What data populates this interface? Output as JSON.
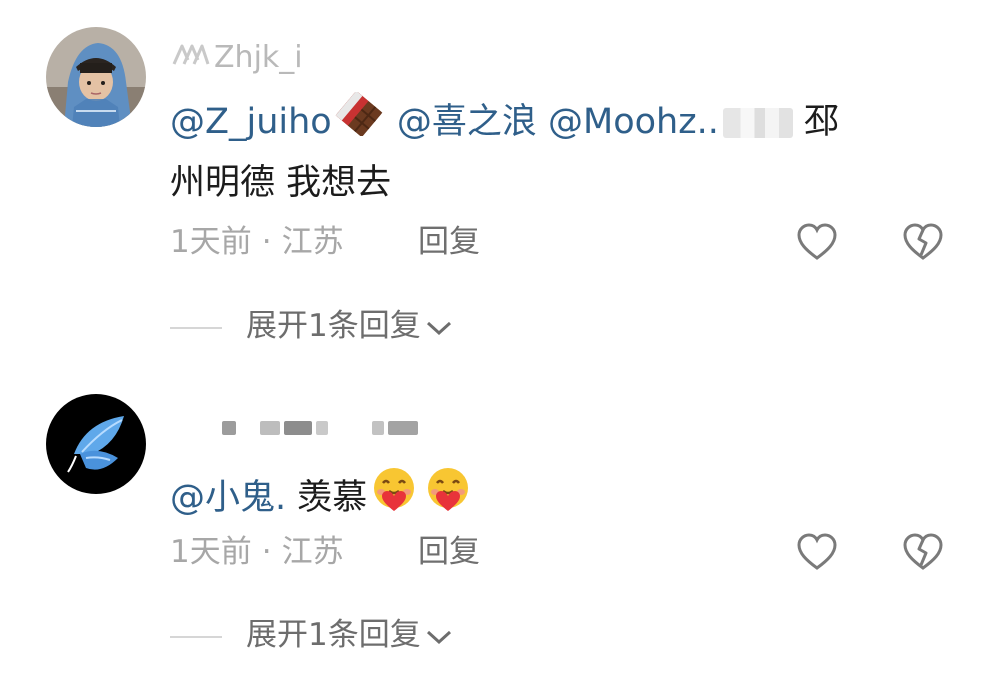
{
  "comments": [
    {
      "username": "Zhjk_i",
      "mentions": [
        "@Z_juiho",
        "@喜之浪",
        "@Moohz.."
      ],
      "text_tail": "邳州明德 我想去",
      "text_tail_a": "邳",
      "text_tail_b": "州明德 我想去",
      "time": "1天前",
      "location": "江苏",
      "reply_label": "回复",
      "expand_label": "展开1条回复"
    },
    {
      "username": "",
      "mention": "@小鬼.",
      "text": "羡慕",
      "time": "1天前",
      "location": "江苏",
      "reply_label": "回复",
      "expand_label": "展开1条回复"
    }
  ],
  "icons": {
    "like": "heart-outline-icon",
    "dislike": "broken-heart-icon",
    "expand": "chevron-down-icon",
    "emoji_1": "chocolate-bar-emoji",
    "emoji_2": "smiling-face-with-hearts-emoji"
  },
  "colors": {
    "mention": "#2f5f8a",
    "meta": "#a7a7a7",
    "text": "#1c1c1c"
  }
}
